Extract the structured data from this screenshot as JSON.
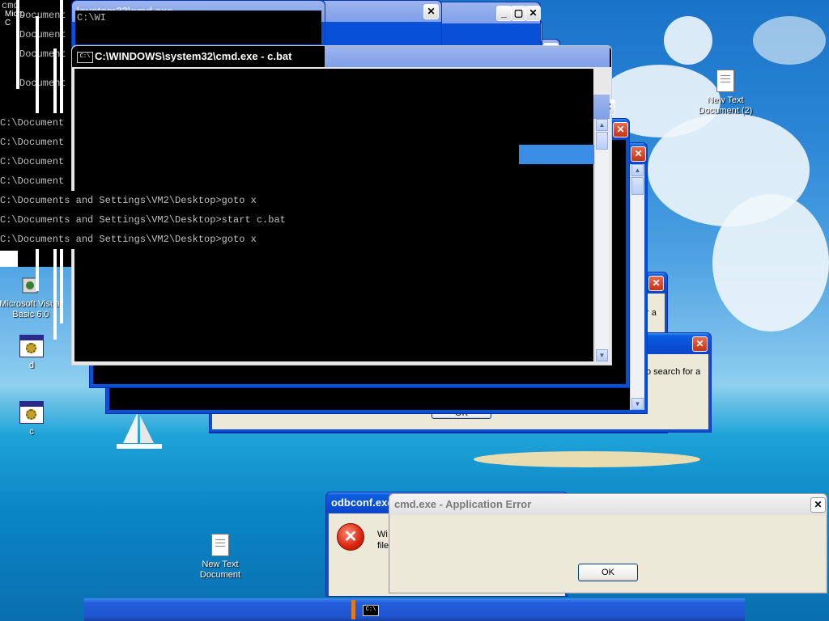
{
  "desktop": {
    "icons": [
      {
        "label": "New Text Document (2)"
      },
      {
        "label": "Microsoft Visual Basic 6.0"
      },
      {
        "label": "d"
      },
      {
        "label": "c"
      },
      {
        "label": "New Text Document"
      }
    ],
    "top_left_fragment": "Micro C"
  },
  "back_windows": {
    "console_lines": [
      "cmd",
      "Document",
      "Document",
      "Document",
      "Document"
    ],
    "cmd_title_fragment": "C:\\WI",
    "top_title_fragment": "\\system32\\cmd.exe"
  },
  "main_cmd": {
    "title": "C:\\WINDOWS\\system32\\cmd.exe - c.bat",
    "icon_text": "C:\\",
    "lines": [
      "C:\\Document",
      "C:\\Document",
      "C:\\Document",
      "C:\\Document",
      "C:\\Documents and Settings\\VM2\\Desktop>goto x",
      "C:\\Documents and Settings\\VM2\\Desktop>start c.bat",
      "C:\\Documents and Settings\\VM2\\Desktop>goto x"
    ]
  },
  "dialogs": {
    "back_text_1": "r a",
    "back_text_2": "o search for a",
    "back_ok": "OK"
  },
  "odbc_error": {
    "title": "odbconf.exe",
    "text_1": "Wi",
    "text_2": "file"
  },
  "cmd_error": {
    "title": "cmd.exe - Application Error",
    "ok_label": "OK"
  },
  "taskbar": {
    "button_text": "C:\\"
  },
  "colors": {
    "xp_title_active": "#0a4ed6",
    "xp_title_inactive": "#7f9fe8",
    "console_bg": "#000000",
    "console_fg": "#c0c0c0",
    "dialog_bg": "#ece9d8"
  }
}
